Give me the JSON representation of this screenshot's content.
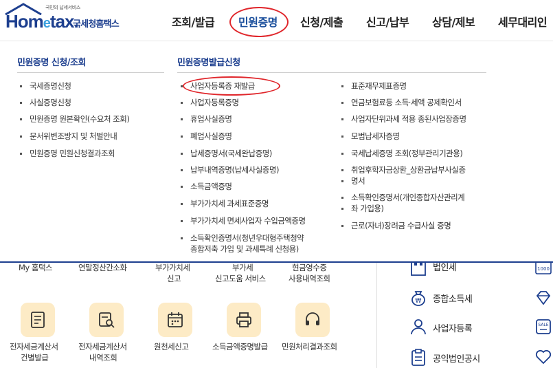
{
  "logo": {
    "tagline": "국민의 납세서비스",
    "brand_a": "Hom",
    "brand_e": "e",
    "brand_b": "tax.",
    "korean_name": "국세청홈택스"
  },
  "gnb": [
    {
      "label": "조회/발급"
    },
    {
      "label": "민원증명"
    },
    {
      "label": "신청/제출"
    },
    {
      "label": "신고/납부"
    },
    {
      "label": "상담/제보"
    },
    {
      "label": "세무대리인"
    }
  ],
  "panel": {
    "col1": {
      "title": "민원증명 신청/조회",
      "items": [
        "국세증명신청",
        "사실증명신청",
        "민원증명 원본확인(수요처 조회)",
        "문서위변조방지 및 처벌안내",
        "민원증명 민원신청결과조회"
      ]
    },
    "col2": {
      "title": "민원증명발급신청",
      "items": [
        "사업자등록증 재발급",
        "사업자등록증명",
        "휴업사실증명",
        "폐업사실증명",
        "납세증명서(국세완납증명)",
        "납부내역증명(납세사실증명)",
        "소득금액증명",
        "부가가치세 과세표준증명",
        "부가가치세 면세사업자 수입금액증명",
        "소득확인증명서(청년우대형주택청약",
        "종합저축 가입 및 과세특례 신청용)"
      ]
    },
    "col3": {
      "items": [
        "표준재무제표증명",
        "연금보험료등 소득·세액 공제확인서",
        "사업자단위과세 적용 종된사업장증명",
        "모범납세자증명",
        "국세납세증명 조회(정부관리기관용)",
        "취업후학자금상환_상환금납부사실증",
        "명서",
        "소득확인증명서(개인종합자산관리계",
        "좌 가입용)",
        "근로(자녀)장려금 수급사실 증명"
      ]
    }
  },
  "bottom": {
    "top_labels": [
      "My 홈택스",
      "연말정산간소화",
      "부가가치세",
      "신고",
      "부가세",
      "신고도움 서비스",
      "현금영수증",
      "사용내역조회"
    ],
    "quick": [
      {
        "line1": "전자세금계산서",
        "line2": "건별발급",
        "icon": "invoice-icon"
      },
      {
        "line1": "전자세금계산서",
        "line2": "내역조회",
        "icon": "invoice-search-icon"
      },
      {
        "line1": "원천세신고",
        "line2": "",
        "icon": "calendar-icon"
      },
      {
        "line1": "소득금액증명발급",
        "line2": "",
        "icon": "printer-icon"
      },
      {
        "line1": "민원처리결과조회",
        "line2": "",
        "icon": "headset-icon"
      }
    ],
    "right": [
      {
        "label": "법인세",
        "icon": "building-icon"
      },
      {
        "label": "종합소득세",
        "icon": "money-bag-icon"
      },
      {
        "label": "사업자등록",
        "icon": "person-icon"
      },
      {
        "label": "공익법인공시",
        "icon": "clipboard-icon"
      }
    ],
    "right_icon_text": "1000",
    "sale_text": "SALE"
  },
  "colors": {
    "brand": "#1d3f8f",
    "highlight_circle": "#e0262b",
    "icon_bg": "#fdebc6"
  }
}
